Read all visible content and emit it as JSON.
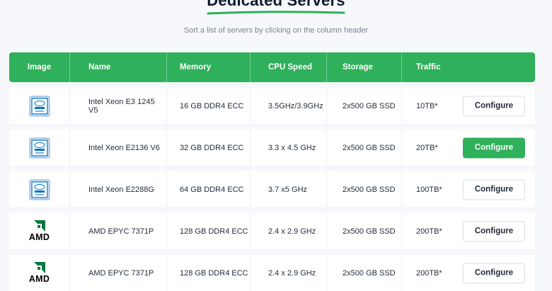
{
  "page": {
    "title": "Dedicated Servers",
    "subtitle": "Sort a list of servers by clicking on the column header"
  },
  "table": {
    "headers": [
      "Image",
      "Name",
      "Memory",
      "CPU Speed",
      "Storage",
      "Traffic"
    ],
    "rows": [
      {
        "logo": "intel-xeon-icon",
        "name": "Intel Xeon E3 1245 V5",
        "memory": "16 GB DDR4 ECC",
        "cpu": "3.5GHz/3.9GHz",
        "storage": "2x500 GB SSD",
        "traffic": "10TB*",
        "action": "Configure"
      },
      {
        "logo": "intel-xeon-icon",
        "name": "Intel Xeon E2136 V6",
        "memory": "32 GB DDR4 ECC",
        "cpu": "3.3 x 4.5 GHz",
        "storage": "2x500 GB SSD",
        "traffic": "20TB*",
        "action": "Configure"
      },
      {
        "logo": "intel-xeon-icon",
        "name": "Intel Xeon E2288G",
        "memory": "64 GB DDR4 ECC",
        "cpu": "3.7 x5 GHz",
        "storage": "2x500 GB SSD",
        "traffic": "100TB*",
        "action": "Configure"
      },
      {
        "logo": "amd-logo-icon",
        "logo_text": "AMD",
        "name": "AMD EPYC 7371P",
        "memory": "128 GB DDR4 ECC",
        "cpu": "2.4 x 2.9 GHz",
        "storage": "2x500 GB SSD",
        "traffic": "200TB*",
        "action": "Configure"
      },
      {
        "logo": "amd-logo-icon",
        "logo_text": "AMD",
        "name": "AMD EPYC 7371P",
        "memory": "128 GB DDR4 ECC",
        "cpu": "2.4 x 2.9 GHz",
        "storage": "2x500 GB SSD",
        "traffic": "200TB*",
        "action": "Configure"
      }
    ]
  },
  "colors": {
    "accent": "#2fb05a",
    "title": "#0f1b2d",
    "intel_blue": "#0071c5"
  }
}
